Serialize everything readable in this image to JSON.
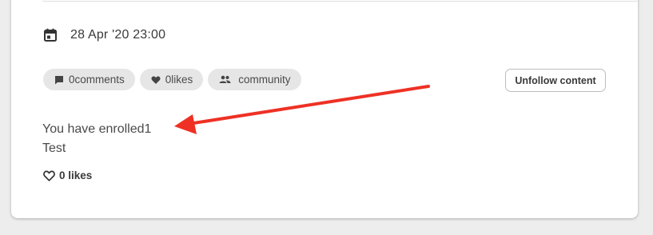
{
  "post": {
    "date": "28 Apr '20 23:00",
    "chips": {
      "comments": "0comments",
      "likes": "0likes",
      "visibility": "community"
    },
    "unfollow_label": "Unfollow content",
    "body_lines": [
      "You have enrolled1",
      "Test"
    ],
    "likes_label": "0 likes"
  },
  "icons": {
    "date": "calendar-icon",
    "comments": "comment-icon",
    "likes_chip": "heart-icon",
    "visibility": "people-icon",
    "like_action": "heart-outline-icon"
  },
  "colors": {
    "annotation_arrow": "#ee3124",
    "chip_background": "#e6e6e6",
    "card_background": "#ffffff",
    "page_background": "#ededed"
  }
}
